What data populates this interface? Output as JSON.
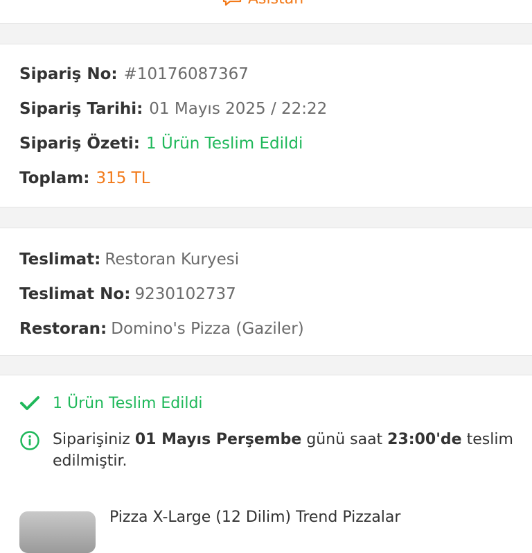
{
  "header": {
    "assistant_label": "Asistan",
    "assistant_icon": "chat-bubble-icon"
  },
  "order": {
    "no_label": "Sipariş No:",
    "no_value": "#10176087367",
    "date_label": "Sipariş Tarihi:",
    "date_value": "01 Mayıs 2025 / 22:22",
    "summary_label": "Sipariş Özeti:",
    "summary_value": "1 Ürün Teslim Edildi",
    "total_label": "Toplam:",
    "total_value": "315 TL"
  },
  "delivery": {
    "type_label": "Teslimat:",
    "type_value": "Restoran Kuryesi",
    "no_label": "Teslimat No:",
    "no_value": "9230102737",
    "restaurant_label": "Restoran:",
    "restaurant_value": "Domino's Pizza (Gaziler)"
  },
  "status": {
    "icon": "check-icon",
    "text": "1 Ürün Teslim Edildi",
    "info_icon": "info-icon",
    "info_pre": "Siparişiniz ",
    "info_day": "01 Mayıs Perşembe",
    "info_mid": " günü saat ",
    "info_time": "23:00'de",
    "info_post": " teslim edilmiştir."
  },
  "product": {
    "name": "Pizza X-Large (12 Dilim) Trend Pizzalar"
  },
  "colors": {
    "green": "#1fb85a",
    "orange": "#f27a1a",
    "text": "#333333",
    "muted": "#6b6b6b"
  }
}
